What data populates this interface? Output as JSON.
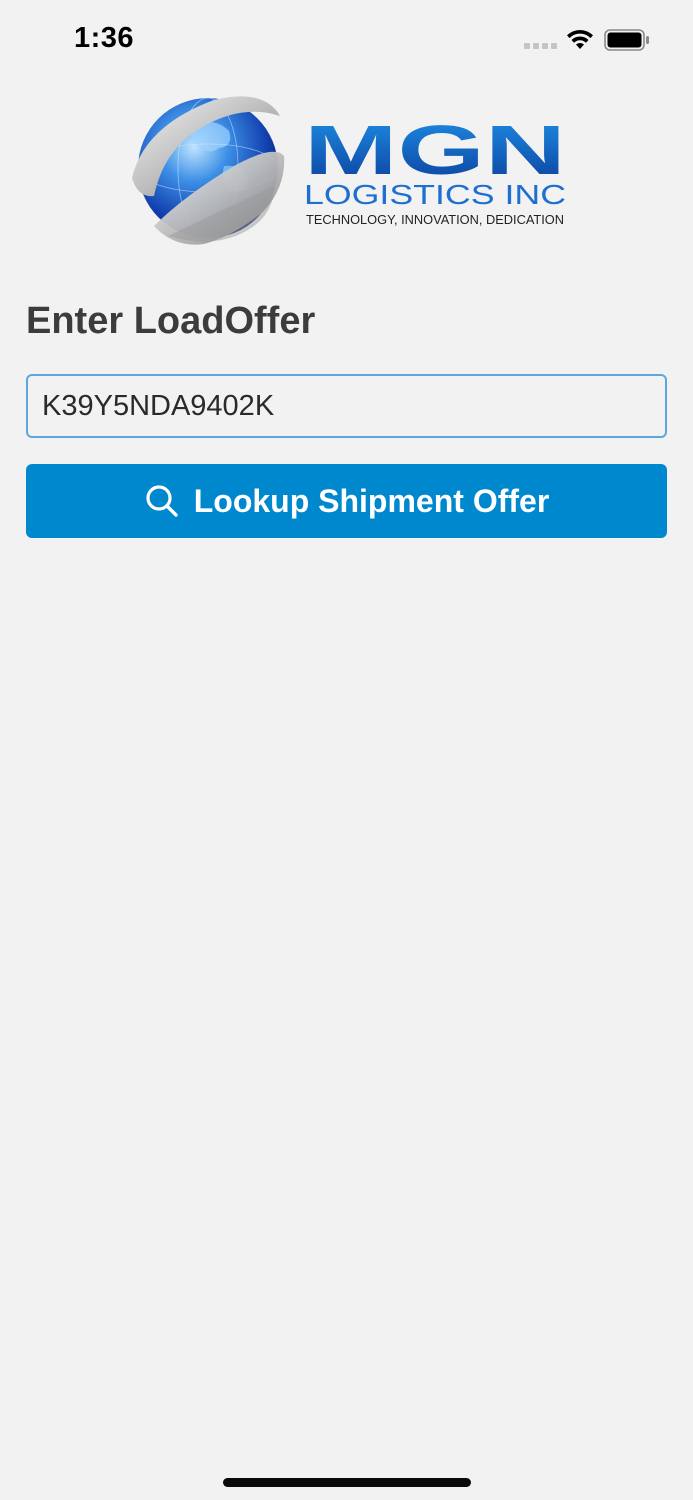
{
  "status_bar": {
    "time": "1:36",
    "signal_icon": "cellular-signal-icon",
    "wifi_icon": "wifi-icon",
    "battery_icon": "battery-icon"
  },
  "logo": {
    "brand": "MGN",
    "line2": "LOGISTICS INC",
    "tagline": "TECHNOLOGY, INNOVATION, DEDICATION",
    "globe_icon": "globe-icon"
  },
  "form": {
    "label": "Enter LoadOffer",
    "input_value": "K39Y5NDA9402K",
    "button_label": "Lookup Shipment Offer",
    "button_icon": "search-icon"
  },
  "colors": {
    "background": "#f2f2f2",
    "accent": "#0088cf",
    "input_border": "#5aa9dc",
    "label_text": "#3c3c3c"
  }
}
